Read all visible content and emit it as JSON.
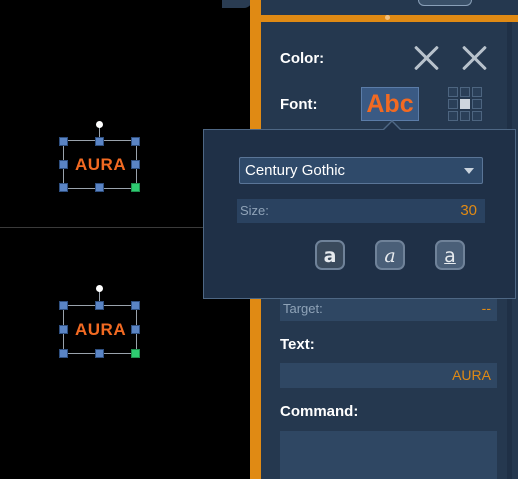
{
  "canvas": {
    "objects": [
      {
        "text": "AURA"
      },
      {
        "text": "AURA"
      }
    ]
  },
  "panel": {
    "color_label": "Color:",
    "font_label": "Font:",
    "font_button_text": "Abc",
    "target_label": "Target:",
    "target_value": "--",
    "text_label": "Text:",
    "text_value": "AURA",
    "command_label": "Command:",
    "command_value": ""
  },
  "font_popup": {
    "font_family": "Century Gothic",
    "size_label": "Size:",
    "size_value": "30",
    "style_buttons": [
      {
        "name": "bold",
        "glyph": "a"
      },
      {
        "name": "italic",
        "glyph": "a"
      },
      {
        "name": "underline",
        "glyph": "a"
      }
    ]
  },
  "colors": {
    "accent_orange": "#e08a14",
    "text_orange": "#f26a22",
    "panel_bg": "#25384f",
    "handle_blue": "#5a84c4",
    "handle_green": "#2ecc71"
  }
}
